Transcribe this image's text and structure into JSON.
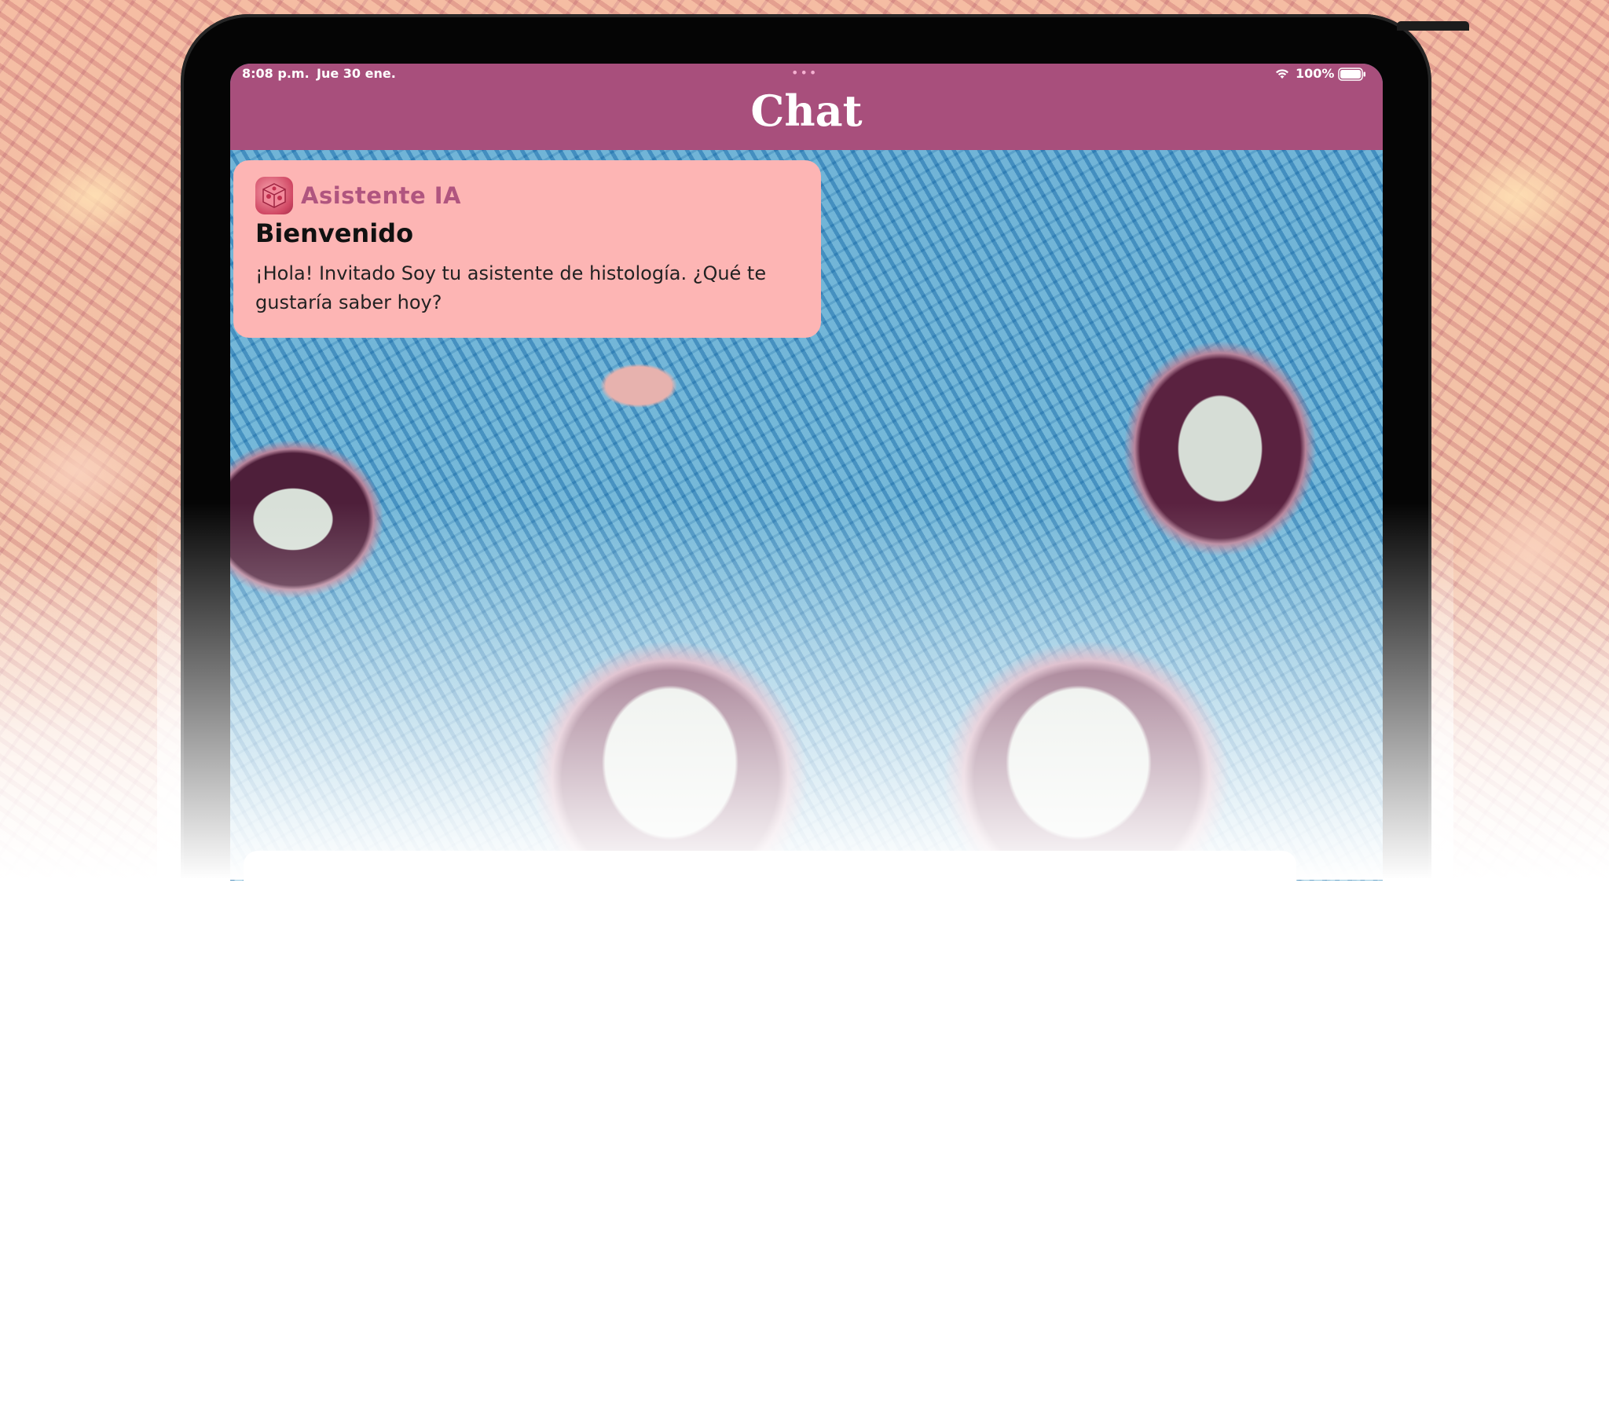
{
  "status_bar": {
    "time": "8:08 p.m.",
    "date": "Jue 30 ene.",
    "multitasking_dots": "•••",
    "battery_percent": "100%",
    "battery_level": 1.0
  },
  "navbar": {
    "title": "Chat"
  },
  "message": {
    "sender": "Asistente IA",
    "title": "Bienvenido",
    "text": "¡Hola! Invitado Soy tu asistente de histología. ¿Qué te gustaría saber hoy?"
  },
  "icons": {
    "avatar": "cell-cube-icon",
    "wifi": "wifi-icon",
    "battery": "battery-icon"
  },
  "colors": {
    "navbar": "#a84f7c",
    "card_background": "#fdb5b4",
    "sender_text": "#b0557f"
  }
}
